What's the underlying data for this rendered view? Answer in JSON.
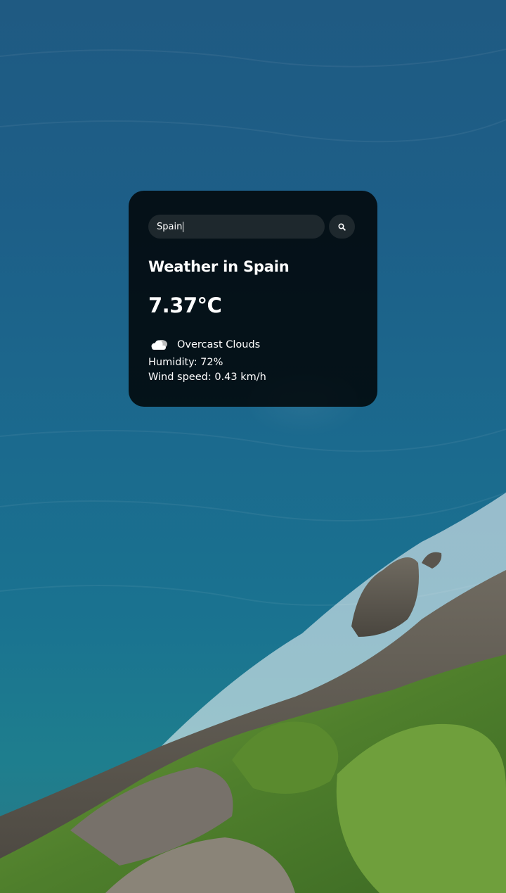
{
  "search": {
    "value": "Spain",
    "icon": "search-icon"
  },
  "weather": {
    "title": "Weather in Spain",
    "temperature": "7.37°C",
    "icon": "overcast-clouds-icon",
    "description": "Overcast Clouds",
    "humidity": "Humidity: 72%",
    "wind": "Wind speed: 0.43 km/h"
  },
  "colors": {
    "card_background": "#000000d1",
    "text": "#ffffff",
    "input_background": "#7c7c7c38"
  }
}
